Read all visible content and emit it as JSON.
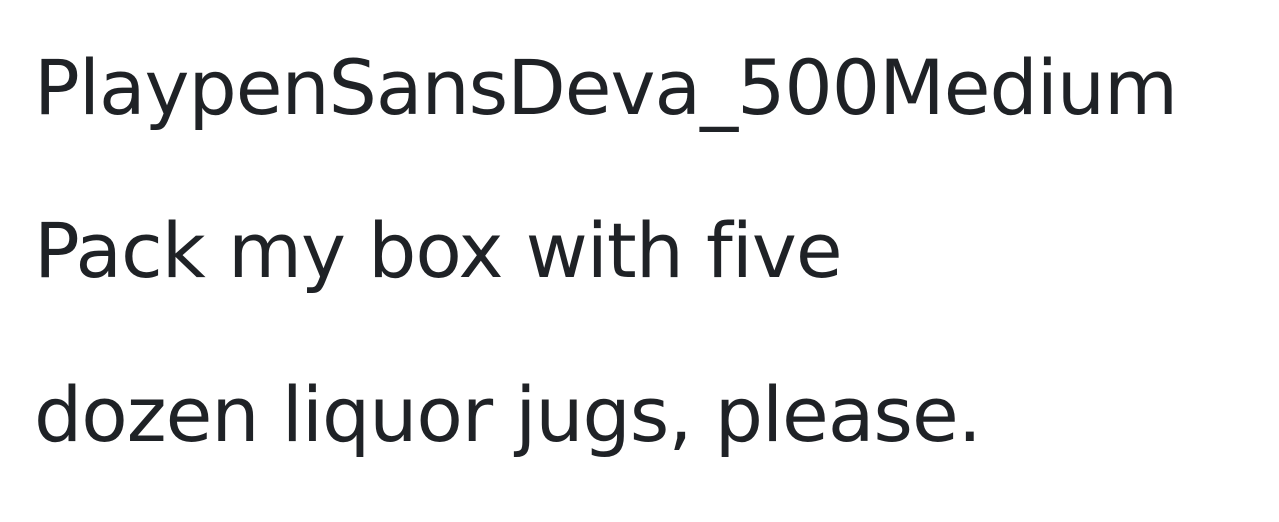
{
  "font_name": "PlaypenSansDeva_500Medium",
  "sample_lines": [
    "Pack my box with five",
    "dozen liquor jugs, please."
  ],
  "colors": {
    "background": "#ffffff",
    "text": "#1f2226"
  }
}
